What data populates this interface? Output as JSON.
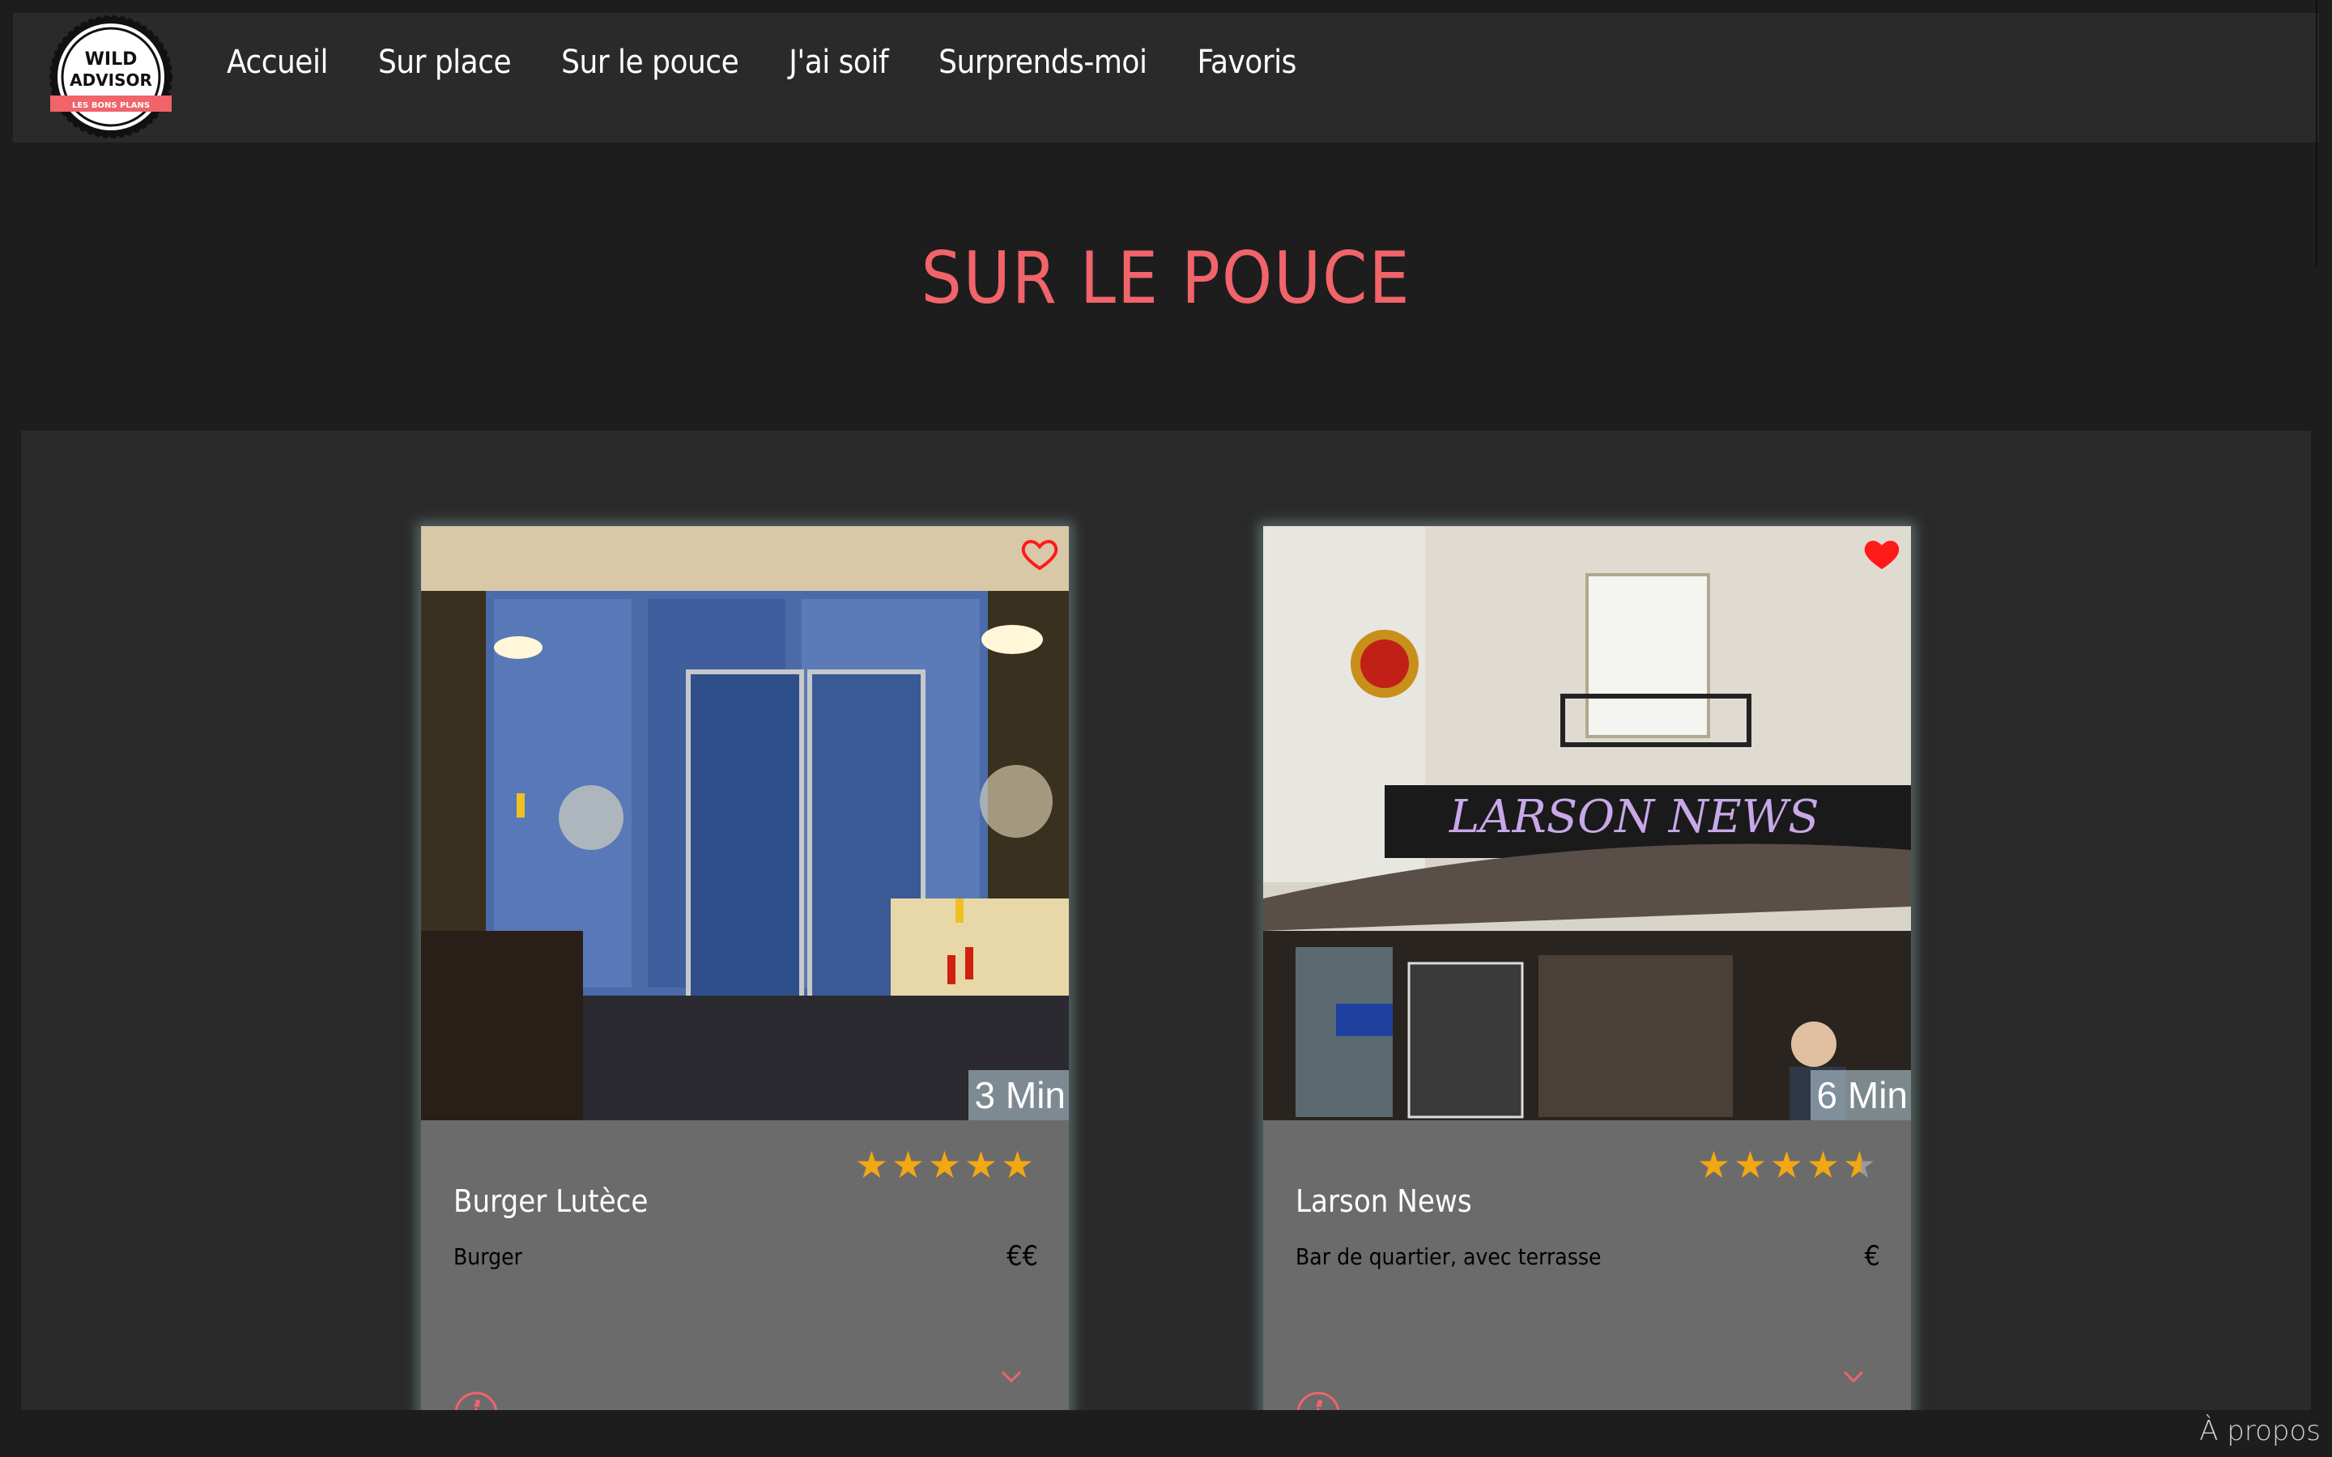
{
  "logo": {
    "line1": "WILD",
    "line2": "ADVISOR",
    "tagline": "LES BONS PLANS"
  },
  "nav": {
    "items": [
      {
        "label": "Accueil"
      },
      {
        "label": "Sur place"
      },
      {
        "label": "Sur le pouce"
      },
      {
        "label": "J'ai soif"
      },
      {
        "label": "Surprends-moi"
      },
      {
        "label": "Favoris"
      }
    ]
  },
  "page": {
    "title": "SUR LE POUCE"
  },
  "cards": [
    {
      "name": "Burger Lutèce",
      "type": "Burger",
      "price": "€€",
      "time": "3 Min",
      "rating": 5,
      "favorite": false,
      "fav_icon": "heart-outline-icon"
    },
    {
      "name": "Larson News",
      "type": "Bar de quartier, avec terrasse",
      "price": "€",
      "time": "6 Min",
      "rating": 4.5,
      "favorite": true,
      "fav_icon": "heart-filled-icon"
    }
  ],
  "footer": {
    "about": "À propos"
  },
  "colors": {
    "accent": "#f0646a",
    "star": "#f3a712",
    "heart": "#ff1a1a",
    "card_bg": "#6b6b6b"
  }
}
